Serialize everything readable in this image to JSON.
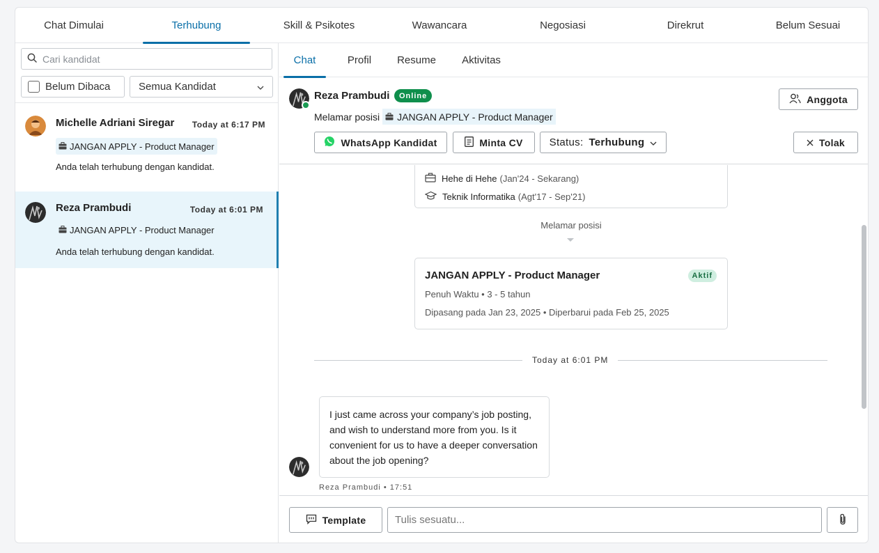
{
  "stage_tabs": [
    {
      "label": "Chat Dimulai"
    },
    {
      "label": "Terhubung"
    },
    {
      "label": "Skill & Psikotes"
    },
    {
      "label": "Wawancara"
    },
    {
      "label": "Negosiasi"
    },
    {
      "label": "Direkrut"
    },
    {
      "label": "Belum Sesuai"
    }
  ],
  "active_stage": "Terhubung",
  "search": {
    "placeholder": "Cari kandidat"
  },
  "filters": {
    "unread_label": "Belum Dibaca",
    "candidate_select": "Semua Kandidat"
  },
  "candidates": [
    {
      "name": "Michelle Adriani Siregar",
      "time": "Today at 6:17 PM",
      "job": "JANGAN APPLY - Product Manager",
      "last_message": "Anda telah terhubung dengan kandidat."
    },
    {
      "name": "Reza Prambudi",
      "time": "Today at 6:01 PM",
      "job": "JANGAN APPLY - Product Manager",
      "last_message": "Anda telah terhubung dengan kandidat."
    }
  ],
  "sub_tabs": [
    {
      "label": "Chat"
    },
    {
      "label": "Profil"
    },
    {
      "label": "Resume"
    },
    {
      "label": "Aktivitas"
    }
  ],
  "header": {
    "name": "Reza Prambudi",
    "online": "Online",
    "applied_label": "Melamar posisi",
    "applied_job": "JANGAN APPLY - Product Manager",
    "member_button": "Anggota",
    "whatsapp_button": "WhatsApp Kandidat",
    "cv_button": "Minta CV",
    "status_label": "Status:",
    "status_value": "Terhubung",
    "reject_button": "Tolak"
  },
  "chat": {
    "experience": "Hehe di Hehe",
    "experience_period": "(Jan'24 - Sekarang)",
    "education": "Teknik Informatika",
    "education_period": "(Agt'17 - Sep'21)",
    "applied_label": "Melamar posisi",
    "job_title": "JANGAN APPLY - Product Manager",
    "job_status": "Aktif",
    "job_meta": "Penuh Waktu • 3 - 5 tahun",
    "job_dates": "Dipasang pada Jan 23, 2025 • Diperbarui pada Feb 25, 2025",
    "time_separator": "Today at 6:01 PM",
    "message": "I just came across your company’s job posting, and wish to understand more from you. Is it convenient for us to have a deeper conversation about the job opening?",
    "message_meta": "Reza Prambudi • 17:51"
  },
  "composer": {
    "template_button": "Template",
    "placeholder": "Tulis sesuatu..."
  },
  "colors": {
    "accent": "#0a6fa8",
    "online": "#0f8f4c",
    "whatsapp": "#25d366",
    "selected_bg": "#e8f5fb"
  }
}
